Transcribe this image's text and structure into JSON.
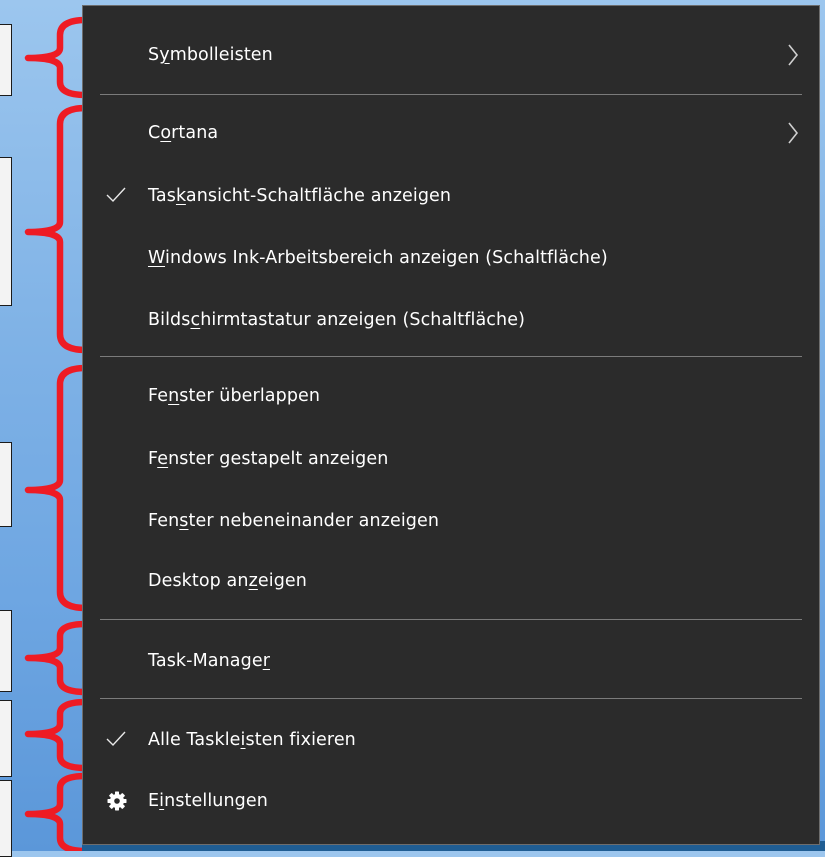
{
  "menu": {
    "items": [
      {
        "pre": "S",
        "acc": "y",
        "post": "mbolleisten",
        "checked": false,
        "submenu": true,
        "icon": "",
        "text": "Symbolleisten"
      },
      {
        "pre": "C",
        "acc": "o",
        "post": "rtana",
        "checked": false,
        "submenu": true,
        "icon": "",
        "text": "Cortana"
      },
      {
        "pre": "Tas",
        "acc": "k",
        "post": "ansicht-Schaltfläche anzeigen",
        "checked": true,
        "submenu": false,
        "icon": "check-icon",
        "text": "Taskansicht-Schaltfläche anzeigen"
      },
      {
        "pre": "",
        "acc": "W",
        "post": "indows Ink-Arbeitsbereich anzeigen (Schaltfläche)",
        "checked": false,
        "submenu": false,
        "icon": "",
        "text": "Windows Ink-Arbeitsbereich anzeigen (Schaltfläche)"
      },
      {
        "pre": "Bilds",
        "acc": "c",
        "post": "hirmtastatur anzeigen (Schaltfläche)",
        "checked": false,
        "submenu": false,
        "icon": "",
        "text": "Bildschirmtastatur anzeigen (Schaltfläche)"
      },
      {
        "pre": "Fe",
        "acc": "n",
        "post": "ster überlappen",
        "checked": false,
        "submenu": false,
        "icon": "",
        "text": "Fenster überlappen"
      },
      {
        "pre": "F",
        "acc": "e",
        "post": "nster gestapelt anzeigen",
        "checked": false,
        "submenu": false,
        "icon": "",
        "text": "Fenster gestapelt anzeigen"
      },
      {
        "pre": "Fen",
        "acc": "s",
        "post": "ter nebeneinander anzeigen",
        "checked": false,
        "submenu": false,
        "icon": "",
        "text": "Fenster nebeneinander anzeigen"
      },
      {
        "pre": "Desktop an",
        "acc": "z",
        "post": "eigen",
        "checked": false,
        "submenu": false,
        "icon": "",
        "text": "Desktop anzeigen"
      },
      {
        "pre": "Task-Manage",
        "acc": "r",
        "post": "",
        "checked": false,
        "submenu": false,
        "icon": "",
        "text": "Task-Manager"
      },
      {
        "pre": "Alle Taskle",
        "acc": "i",
        "post": "sten fixieren",
        "checked": true,
        "submenu": false,
        "icon": "check-icon",
        "text": "Alle Taskleisten fixieren"
      },
      {
        "pre": "E",
        "acc": "i",
        "post": "nstellungen",
        "checked": false,
        "submenu": false,
        "icon": "gear-icon",
        "text": "Einstellungen"
      }
    ]
  },
  "colors": {
    "menu_bg": "#2b2b2b",
    "menu_text": "#ffffff",
    "separator": "#7b7b7b",
    "annotation_bracket": "#ee1b24",
    "desktop": "#7fb2e6"
  }
}
